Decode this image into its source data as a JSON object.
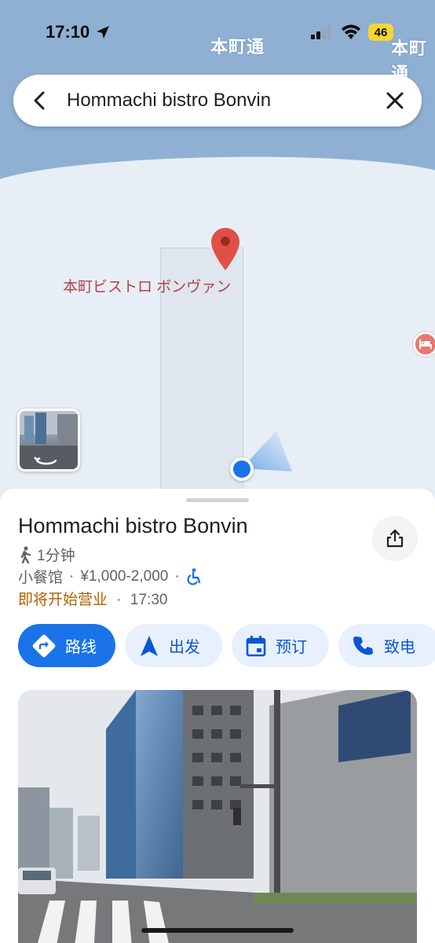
{
  "status_bar": {
    "time": "17:10",
    "battery": "46"
  },
  "map": {
    "street_label_1": "本町通",
    "street_label_2": "本町通",
    "pin_label": "本町ビストロ ボンヴァン"
  },
  "search": {
    "query": "Hommachi bistro Bonvin"
  },
  "place": {
    "name": "Hommachi bistro Bonvin",
    "walk_time": "1分钟",
    "category": "小餐馆",
    "price": "¥1,000-2,000",
    "hours_status": "即将开始营业",
    "hours_time": "17:30"
  },
  "actions": {
    "directions": "路线",
    "start": "出发",
    "reserve": "预订",
    "call": "致电"
  },
  "colors": {
    "accent": "#1a73e8",
    "pin": "#ea4335",
    "hours_status": "#b06000"
  }
}
